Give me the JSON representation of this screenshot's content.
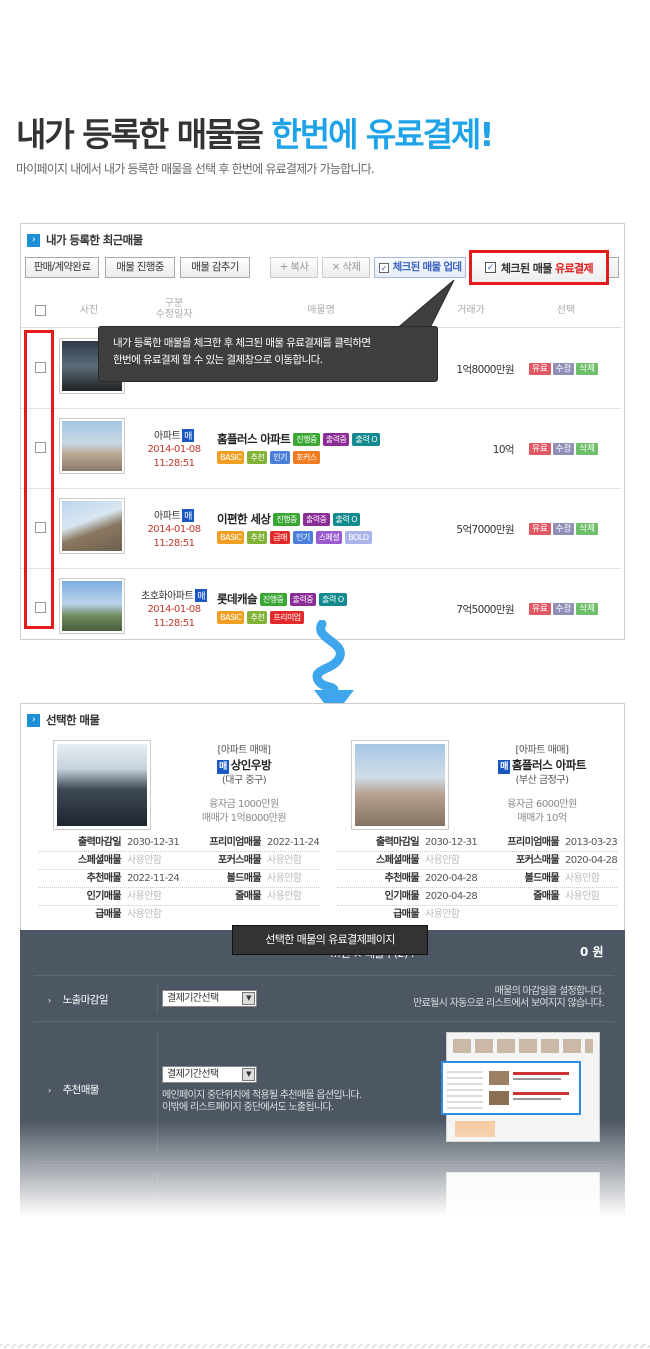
{
  "hero": {
    "title_pre": "내가 등록한 매물을",
    "title_hl": "한번에 유료결제!",
    "subtitle": "마이페이지 내에서 내가 등록한 매물을 선택 후 한번에 유료결제가 가능합니다."
  },
  "panel1": {
    "title": "내가 등록한 최근매물",
    "btn_sold": "판매/계약완료",
    "btn_progress": "매물 진행중",
    "btn_hide": "매물 감추기",
    "btn_copy": "+ 복사",
    "btn_delete": "× 삭제",
    "btn_update": "체크된 매물 업데",
    "btn_paid_pre": "체크된 매물",
    "btn_paid_red": "유료결제",
    "headers": {
      "photo": "사진",
      "kind": "구분",
      "modified": "수정일자",
      "name": "매물명",
      "price": "거래가",
      "select": "선택"
    },
    "tooltip_line1": "내가 등록한 매물을 체크한 후 체크된 매물 유료결제를 클릭하면",
    "tooltip_line2": "한번에 유료결제 할 수 있는 결제창으로 이동합니다.",
    "rows": [
      {
        "kind": "",
        "date": "",
        "time": "",
        "name": "",
        "price": "1억8000만원"
      },
      {
        "kind": "아파트",
        "date": "2014-01-08",
        "time": "11:28:51",
        "name": "홈플러스 아파트",
        "price": "10억"
      },
      {
        "kind": "아파트",
        "date": "2014-01-08",
        "time": "11:28:51",
        "name": "이편한 세상",
        "price": "5억7000만원"
      },
      {
        "kind": "초호화아파트",
        "date": "2014-01-08",
        "time": "11:28:51",
        "name": "롯데캐슬",
        "price": "7억5000만원"
      }
    ],
    "mae": "매",
    "tag_progress": "진행중",
    "tag_out": "출력중",
    "tag_out_o": "출력 O",
    "tag_basic": "BASIC",
    "tag_rec": "추천",
    "tag_pop": "인기",
    "tag_focus": "포커스",
    "tag_urgent": "급매",
    "tag_special": "스페셜",
    "tag_bold": "BOLD",
    "tag_premium": "프리미엄",
    "act_paid": "유료",
    "act_edit": "수정",
    "act_del": "삭제"
  },
  "panel2": {
    "title": "선택한 매물",
    "cards": [
      {
        "type": "[아파트 매매]",
        "name": "상인우방",
        "region": "(대구 중구)",
        "loan": "융자금 1000만원",
        "sale": "매매가 1억8000만원",
        "rows": [
          [
            "출력마감일",
            "2030-12-31",
            "프리미엄매물",
            "2022-11-24"
          ],
          [
            "스페셜매물",
            "사용안함",
            "포커스매물",
            "사용안함"
          ],
          [
            "추천매물",
            "2022-11-24",
            "볼드매물",
            "사용안함"
          ],
          [
            "인기매물",
            "사용안함",
            "줄매물",
            "사용안함"
          ],
          [
            "급매물",
            "사용안함",
            "",
            ""
          ]
        ]
      },
      {
        "type": "[아파트 매매]",
        "name": "홈플러스 아파트",
        "region": "(부산 금정구)",
        "loan": "융자금 6000만원",
        "sale": "매매가 10억",
        "rows": [
          [
            "출력마감일",
            "2030-12-31",
            "프리미엄매물",
            "2013-03-23"
          ],
          [
            "스페셜매물",
            "사용안함",
            "포커스매물",
            "2020-04-28"
          ],
          [
            "추천매물",
            "2020-04-28",
            "볼드매물",
            "사용안함"
          ],
          [
            "인기매물",
            "2020-04-28",
            "줄매물",
            "사용안함"
          ],
          [
            "급매물",
            "사용안함",
            "",
            ""
          ]
        ]
      }
    ]
  },
  "payment": {
    "tooltip": "선택한 매물의 유료결제페이지",
    "total_label": "…션 × 매물수(2) :",
    "total_value": "0 원",
    "row1_label": "노출마감일",
    "row1_select": "결제기간선택",
    "row1_desc1": "매물의 마감일을 설정합니다.",
    "row1_desc2": "만료될시 자동으로 리스트에서 보여지지 않습니다.",
    "row2_label": "추천매물",
    "row2_select": "결제기간선택",
    "row2_desc1": "메인페이지 중단위치에 적용될 추천매물 옵션입니다.",
    "row2_desc2": "이밖에 리스트페이지 중단에서도 노출됩니다."
  }
}
